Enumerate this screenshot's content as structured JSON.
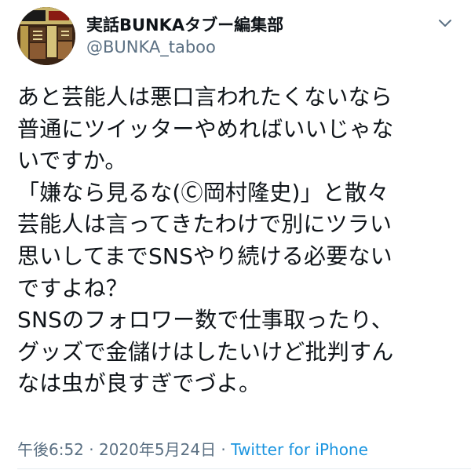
{
  "account": {
    "display_name": "実話BUNKAタブー編集部",
    "handle": "@BUNKA_taboo",
    "avatar_icon": "magazine-cover-avatar"
  },
  "menu": {
    "caret_icon": "chevron-down-icon"
  },
  "tweet": {
    "lines": [
      "あと芸能人は悪口言われたくないなら",
      "普通にツイッターやめればいいじゃな",
      "いですか。",
      "「嫌なら見るな(Ⓒ岡村隆史)」と散々",
      "芸能人は言ってきたわけで別にツラい",
      "思いしてまでSNSやり続ける必要ない",
      "ですよね？",
      "SNSのフォロワー数で仕事取ったり、",
      "グッズで金儲けはしたいけど批判すん",
      "なは虫が良すぎでづよ。"
    ]
  },
  "meta": {
    "time": "午後6:52",
    "separator1": " · ",
    "date": "2020年5月24日",
    "separator2": " · ",
    "source": "Twitter for iPhone"
  },
  "colors": {
    "text": "#0f1419",
    "secondary": "#5b7083",
    "link": "#1b95e0"
  }
}
